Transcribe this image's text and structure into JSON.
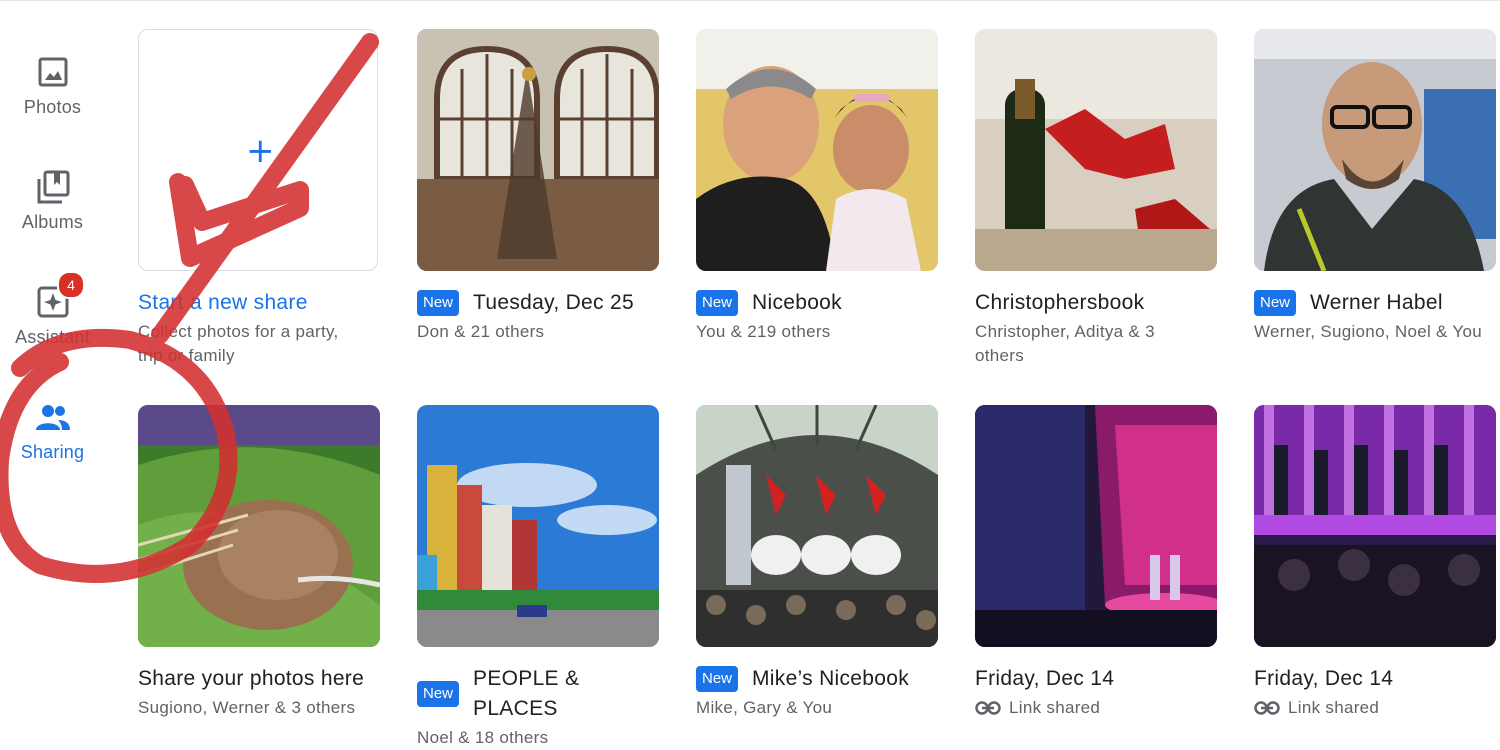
{
  "nav": {
    "photos": "Photos",
    "albums": "Albums",
    "assistant": "Assistant",
    "assistant_badge": "4",
    "sharing": "Sharing"
  },
  "new_share": {
    "plus": "+",
    "title": "Start a new share",
    "subtitle": "Collect photos for a party, trip or family"
  },
  "shares": [
    {
      "badge": "New",
      "title": "Tuesday, Dec 25",
      "subtitle": "Don & 21 others"
    },
    {
      "badge": "New",
      "title": "Nicebook",
      "subtitle": "You & 219 others"
    },
    {
      "badge": "",
      "title": "Christophersbook",
      "subtitle": "Christopher, Aditya & 3 others"
    },
    {
      "badge": "New",
      "title": "Werner Habel",
      "subtitle": "Werner, Sugiono, Noel & You"
    },
    {
      "badge": "",
      "title": "Share your photos here",
      "subtitle": "Sugiono, Werner & 3 others"
    },
    {
      "badge": "New",
      "title": "PEOPLE & PLACES",
      "subtitle": "Noel & 18 others"
    },
    {
      "badge": "New",
      "title": "Mike’s Nicebook",
      "subtitle": "Mike, Gary & You"
    },
    {
      "badge": "",
      "title": "Friday, Dec 14",
      "subtitle": "Link shared"
    },
    {
      "badge": "",
      "title": "Friday, Dec 14",
      "subtitle": "Link shared"
    }
  ],
  "colors": {
    "accent": "#1a73e8",
    "badge": "#d93025",
    "annotation": "#d32f2f"
  }
}
